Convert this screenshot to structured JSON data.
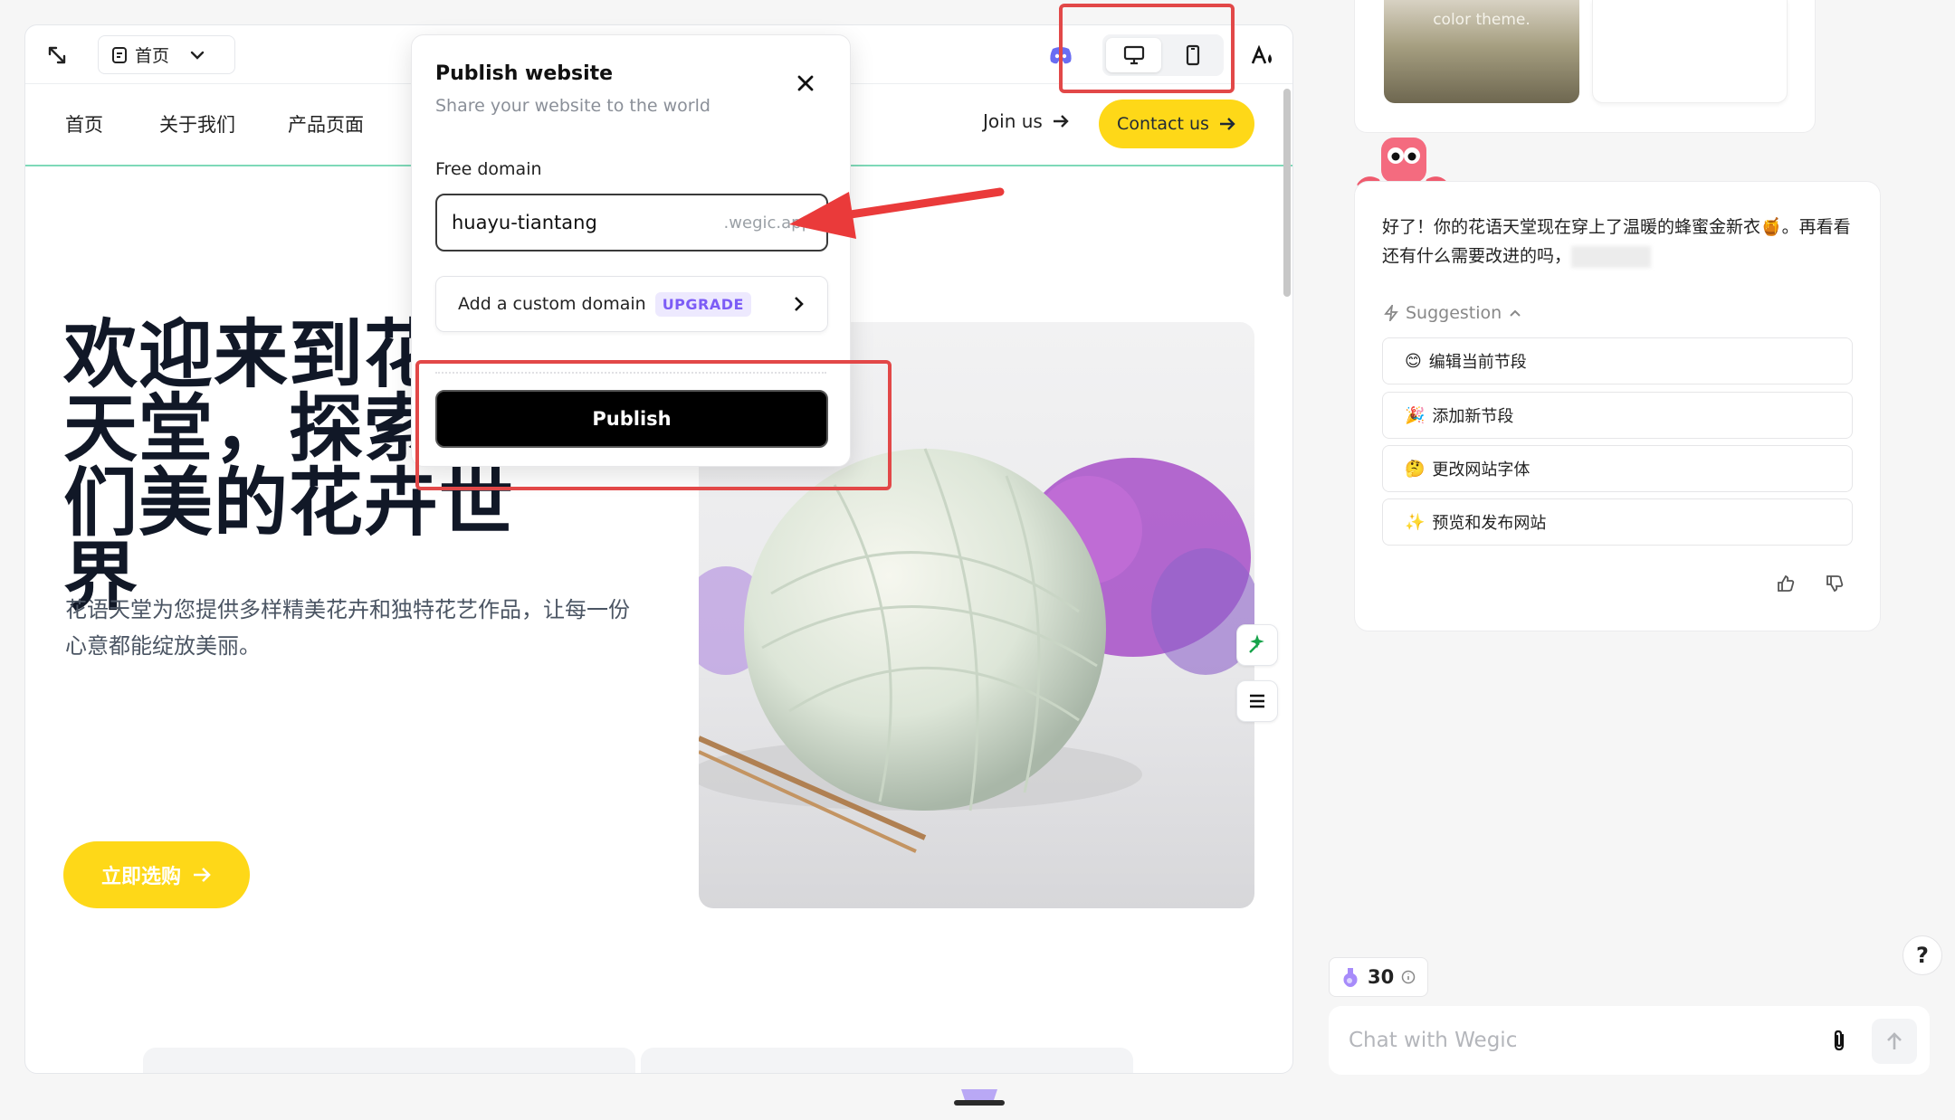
{
  "editor": {
    "page_select": "首页",
    "site": {
      "nav": [
        "首页",
        "关于我们",
        "产品页面"
      ],
      "join": "Join us",
      "contact": "Contact us",
      "hero_title": "欢迎来到花语天堂，探索我们美的花卉世界",
      "hero_sub": "花语天堂为您提供多样精美花卉和独特花艺作品，让每一份心意都能绽放美丽。",
      "shop_button": "立即选购"
    }
  },
  "publish_modal": {
    "title": "Publish website",
    "subtitle": "Share your website to the world",
    "free_domain_label": "Free domain",
    "domain_value": "huayu-tiantang",
    "domain_suffix": ".wegic.app",
    "custom_domain": "Add a custom domain",
    "upgrade_badge": "UPGRADE",
    "publish_button": "Publish"
  },
  "chat": {
    "theme_caption": "color theme.",
    "message": "好了！你的花语天堂现在穿上了温暖的蜂蜜金新衣🍯。再看看还有什么需要改进的吗，",
    "suggestion_label": "Suggestion",
    "suggestions": [
      {
        "emoji": "😊",
        "text": "编辑当前节段"
      },
      {
        "emoji": "🎉",
        "text": "添加新节段"
      },
      {
        "emoji": "🤔",
        "text": "更改网站字体"
      },
      {
        "emoji": "✨",
        "text": "预览和发布网站"
      }
    ],
    "credits": "30",
    "input_placeholder": "Chat with Wegic",
    "help": "?"
  },
  "colors": {
    "accent_yellow": "#fed818",
    "annotation_red": "#e24848",
    "upgrade_purple": "#7c5cf6",
    "nav_underline": "#7ed9b8"
  }
}
